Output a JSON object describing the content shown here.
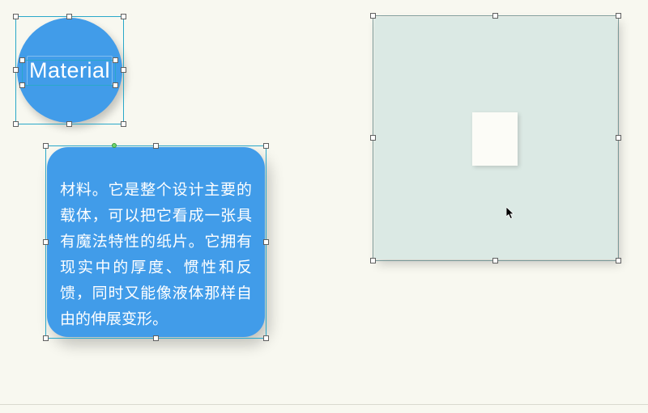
{
  "shapes": {
    "circle_label": "Material",
    "card_body": "材料。它是整个设计主要的载体，可以把它看成一张具有魔法特性的纸片。它拥有现实中的厚度、惯性和反馈，同时又能像液体那样自由的伸展变形。"
  },
  "colors": {
    "accent_blue": "#419ce9",
    "panel_bg": "#dbe9e4",
    "canvas_bg": "#f8f8f0"
  }
}
